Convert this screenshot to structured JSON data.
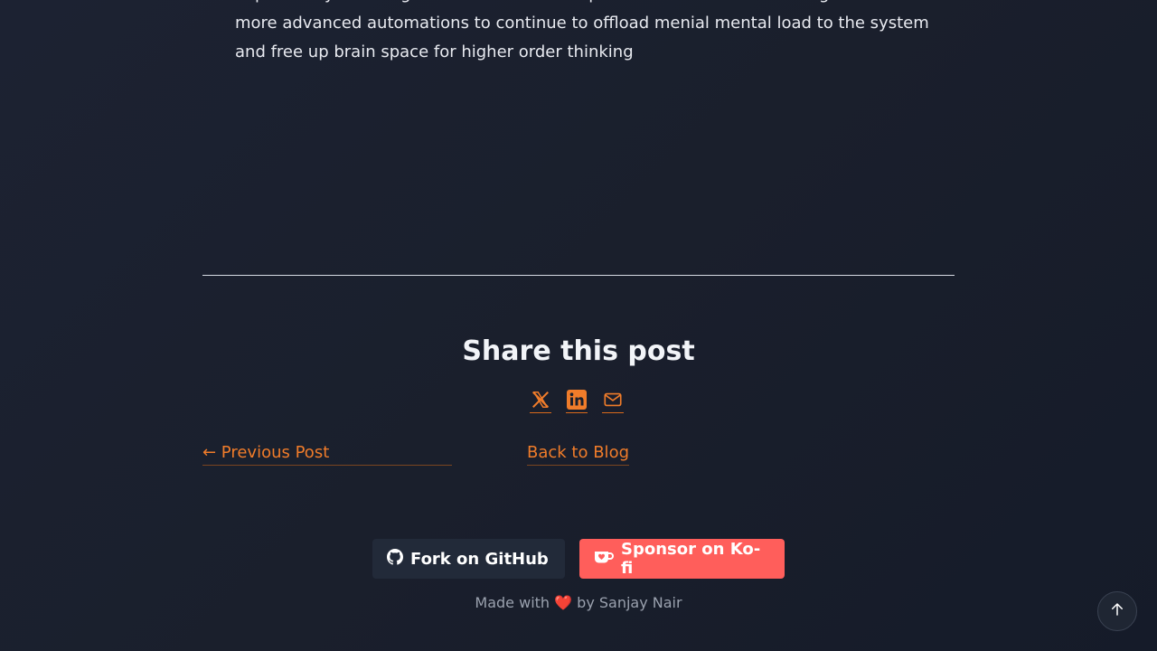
{
  "article": {
    "paragraph": "Explore ways to integrate LLMs into the corpus of all these tools and begin to create more advanced automations to continue to offload menial mental load to the system and free up brain space for higher order thinking"
  },
  "share": {
    "title": "Share this post",
    "icons": [
      "x-twitter-icon",
      "linkedin-icon",
      "mail-icon"
    ]
  },
  "post_nav": {
    "previous": "← Previous Post",
    "back": "Back to Blog"
  },
  "footer": {
    "github_label": "Fork on GitHub",
    "kofi_label": "Sponsor on Ko-fi",
    "made_with_prefix": "Made with",
    "heart": "❤️",
    "made_with_suffix": "by Sanjay Nair"
  },
  "colors": {
    "accent": "#f07c2a",
    "kofi": "#ff5e5b",
    "github_bg": "#222a39",
    "background": "#1a1f2c"
  }
}
